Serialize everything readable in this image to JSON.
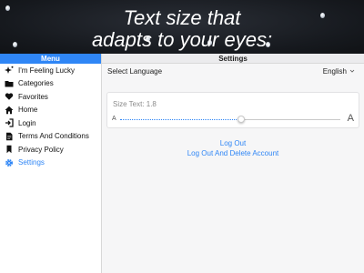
{
  "banner": {
    "line1": "Text size that",
    "line2": "adapts to your eyes:"
  },
  "sidebar": {
    "title": "Menu",
    "items": [
      {
        "label": "I'm Feeling Lucky",
        "icon": "sparkle-icon"
      },
      {
        "label": "Categories",
        "icon": "folder-icon"
      },
      {
        "label": "Favorites",
        "icon": "heart-icon"
      },
      {
        "label": "Home",
        "icon": "home-icon"
      },
      {
        "label": "Login",
        "icon": "login-icon"
      },
      {
        "label": "Terms And Conditions",
        "icon": "document-icon"
      },
      {
        "label": "Privacy Policy",
        "icon": "bookmark-icon"
      },
      {
        "label": "Settings",
        "icon": "gear-icon",
        "active": true
      }
    ]
  },
  "main": {
    "title": "Settings",
    "language_label": "Select Language",
    "language_value": "English",
    "size_text": "Size Text: 1.8",
    "slider_value": 1.8,
    "slider_min_label": "A",
    "slider_max_label": "A",
    "logout_label": "Log Out",
    "logout_delete_label": "Log Out And Delete Account"
  },
  "colors": {
    "accent": "#2f86f6",
    "banner_bg": "#16191e"
  }
}
